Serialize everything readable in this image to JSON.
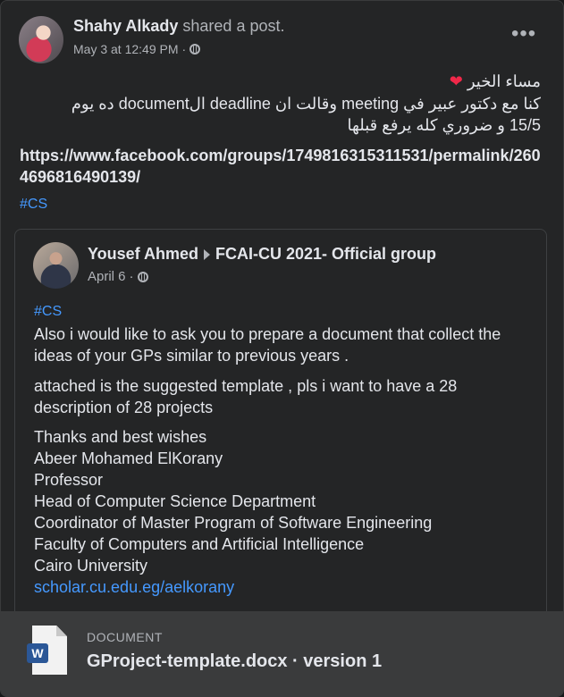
{
  "post": {
    "author": "Shahy Alkady",
    "action": "shared a post.",
    "date": "May 3 at 12:49 PM",
    "more": "•••",
    "arabic_line1": "مساء الخير",
    "arabic_line2": "كنا مع دكتور عبير في meeting وقالت ان deadline الdocument ده يوم",
    "arabic_line3": "15/5 و ضروري كله يرفع قبلها",
    "link": "https://www.facebook.com/groups/1749816315311531/permalink/2604696816490139/",
    "hashtag": "#CS"
  },
  "shared": {
    "author": "Yousef Ahmed",
    "group": "FCAI-CU 2021- Official group",
    "date": "April 6",
    "hashtag": "#CS",
    "para1": "Also i would like to ask you to prepare a document that collect the ideas of your GPs similar to previous years .",
    "para2": "attached is the suggested template , pls i want to have a 28 description of 28 projects",
    "sig": [
      "Thanks and best wishes",
      "Abeer Mohamed ElKorany",
      "Professor",
      "Head of Computer Science Department",
      "Coordinator of Master Program of Software Engineering",
      "Faculty of Computers and Artificial Intelligence",
      "Cairo University"
    ],
    "site": "scholar.cu.edu.eg/aelkorany"
  },
  "attachment": {
    "label": "DOCUMENT",
    "name": "GProject-template.docx · version 1",
    "icon": "W"
  },
  "colors": {
    "link": "#4599ff",
    "heart": "#f02849",
    "card": "#242526"
  }
}
